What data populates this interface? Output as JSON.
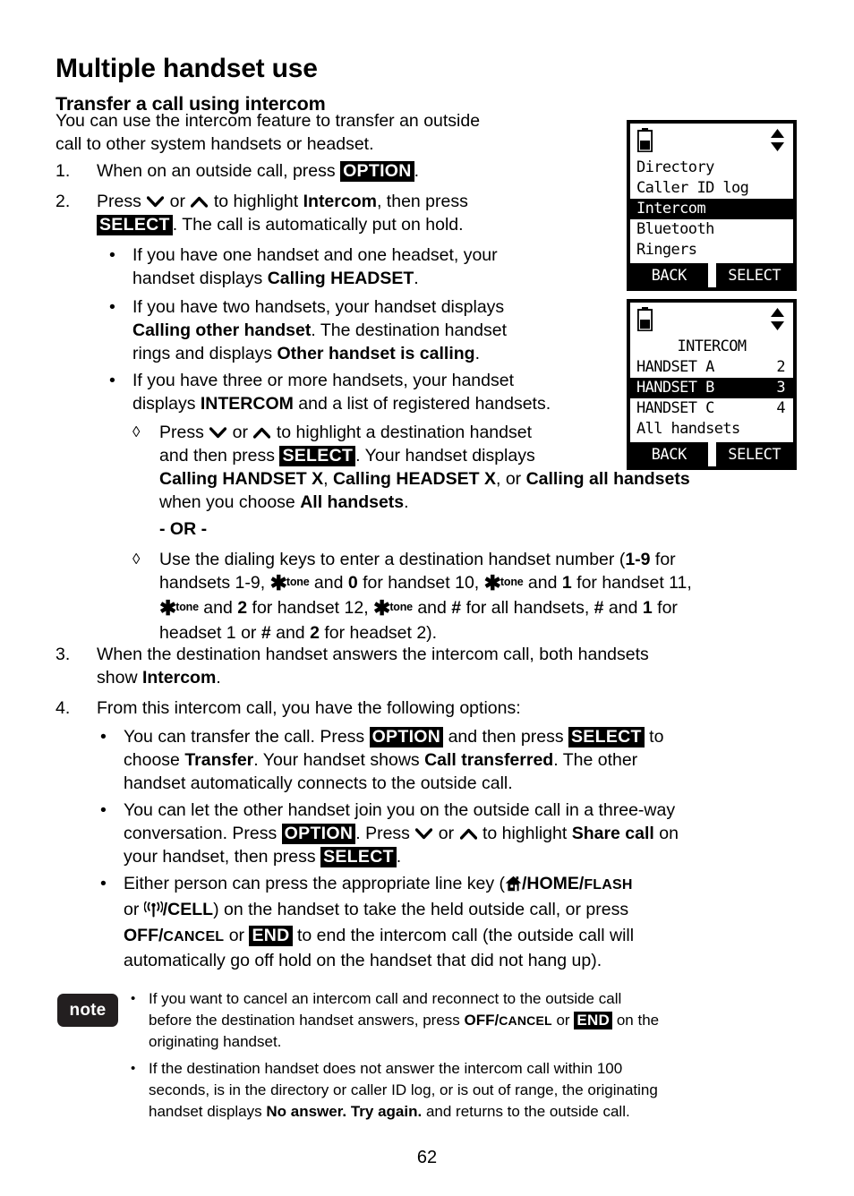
{
  "document": {
    "chapter_title": "Multiple handset use",
    "section_title": "Transfer a call using intercom",
    "page_number": "62"
  },
  "intro": {
    "line1": "You can use the intercom feature to transfer an outside",
    "line2": "call to other system handsets or headset."
  },
  "steps": {
    "s1": {
      "marker": "1.",
      "text_before": "When on an outside call, press ",
      "key": "OPTION",
      "text_after": "."
    },
    "s2": {
      "marker": "2.",
      "l1_a": "Press ",
      "l1_b": " or ",
      "l1_c": " to highlight ",
      "l1_bold": "Intercom",
      "l1_d": ", then press",
      "l2_key": "SELECT",
      "l2_after": ". The call is automatically put on hold.",
      "bullets": [
        {
          "l1": "If you have one handset and one headset, your",
          "l2_a": "handset displays ",
          "l2_bold": "Calling HEADSET",
          "l2_b": "."
        },
        {
          "l1": "If you have two handsets, your handset displays",
          "l2_bold": "Calling other handset",
          "l2_a": ". The destination handset",
          "l3_a": "rings and displays ",
          "l3_bold": "Other handset is calling",
          "l3_b": "."
        },
        {
          "l1": "If you have three or more handsets, your handset",
          "l2_a": "displays ",
          "l2_bold": "INTERCOM",
          "l2_b": " and a list of registered handsets."
        }
      ],
      "sub_items": [
        {
          "marker": "◊",
          "l1_a": "Press ",
          "l1_b": " or ",
          "l1_c": " to highlight a destination handset",
          "l2_a": "and then press ",
          "l2_key": "SELECT",
          "l2_b": ". Your handset displays",
          "l3_bold1": "Calling HANDSET X",
          "l3_sep1": ", ",
          "l3_bold2": "Calling HEADSET X",
          "l3_sep2": ", or ",
          "l3_bold3": "Calling all handsets",
          "l4_a": "when you choose ",
          "l4_bold": "All handsets",
          "l4_b": "."
        }
      ],
      "or_label": "- OR -",
      "sub_items2": [
        {
          "marker": "◊",
          "l1_a": "Use the dialing keys to enter a destination handset number (",
          "l1_b1": "1-9",
          "l1_c": " for",
          "l2_a": "handsets 1-9, ",
          "l2_star": "tone",
          "l2_b": " and ",
          "l2_b1": "0",
          "l2_c": " for handset 10, ",
          "l2_d": " and ",
          "l2_d1": "1",
          "l2_e": " for handset 11,",
          "l3_a": " and ",
          "l3_a1": "2",
          "l3_b": " for handset 12, ",
          "l3_c": " and ",
          "l3_c1": "#",
          "l3_d": " for all handsets, ",
          "l3_d1": "#",
          "l3_e": " and ",
          "l3_e1": "1",
          "l3_f": " for",
          "l4_a": "headset 1 or ",
          "l4_a1": "#",
          "l4_b": " and ",
          "l4_b1": "2",
          "l4_c": " for headset 2)."
        }
      ]
    },
    "s3": {
      "marker": "3.",
      "l1": "When the destination handset answers the intercom call, both handsets",
      "l2_a": "show ",
      "l2_bold": "Intercom",
      "l2_b": "."
    },
    "s4": {
      "marker": "4.",
      "l1": "From this intercom call, you have the following options:",
      "bullets": [
        {
          "l1_a": "You can transfer the call. Press ",
          "l1_key1": "OPTION",
          "l1_b": " and then press ",
          "l1_key2": "SELECT",
          "l1_c": " to",
          "l2_a": "choose ",
          "l2_bold1": "Transfer",
          "l2_b": ". Your handset shows ",
          "l2_bold2": "Call transferred",
          "l2_c": ". The other",
          "l3": "handset automatically connects to the outside call."
        },
        {
          "l1": "You can let the other handset join you on the outside call in a three-way",
          "l2_a": "conversation. Press ",
          "l2_key": "OPTION",
          "l2_b": ". Press ",
          "l2_c": " or ",
          "l2_d": " to highlight ",
          "l2_bold": "Share call",
          "l2_e": " on",
          "l3_a": "your handset, then press ",
          "l3_key": "SELECT",
          "l3_b": "."
        },
        {
          "l1_a": "Either person can press the appropriate line key (",
          "l1_home": "/HOME/",
          "l1_flash": "FLASH",
          "l2_a": "or ",
          "l2_cell": "/CELL",
          "l2_b": ") on the handset to take the held outside call, or press",
          "l3_off": "OFF/",
          "l3_cancel": "CANCEL",
          "l3_a": " or ",
          "l3_key": "END",
          "l3_b": " to end the intercom call (the outside call will",
          "l4": "automatically go off hold on the handset that did not hang up)."
        }
      ]
    }
  },
  "note": {
    "label": "note",
    "items": [
      {
        "l1": "If you want to cancel an intercom call and reconnect to the outside call",
        "l2_a": "before the destination handset answers, press ",
        "l2_off": "OFF/",
        "l2_cancel": "CANCEL",
        "l2_b": " or ",
        "l2_key": "END",
        "l2_c": " on the",
        "l3": "originating handset."
      },
      {
        "l1": "If the destination handset does not answer the intercom call within 100",
        "l2": "seconds, is in the directory or caller ID log, or is out of range, the originating",
        "l3_a": "handset displays ",
        "l3_bold": "No answer. Try again.",
        "l3_b": " and returns to the outside call."
      }
    ]
  },
  "lcd_screens": [
    {
      "id": "menu-screen",
      "rows": [
        {
          "label": "Directory",
          "value": "",
          "selected": false,
          "centered": false
        },
        {
          "label": "Caller ID log",
          "value": "",
          "selected": false,
          "centered": false
        },
        {
          "label": "Intercom",
          "value": "",
          "selected": true,
          "centered": false
        },
        {
          "label": "Bluetooth",
          "value": "",
          "selected": false,
          "centered": false
        },
        {
          "label": "Ringers",
          "value": "",
          "selected": false,
          "centered": false
        }
      ],
      "softkeys": {
        "left": "BACK",
        "right": "SELECT"
      }
    },
    {
      "id": "intercom-screen",
      "rows": [
        {
          "label": "INTERCOM",
          "value": "",
          "selected": false,
          "centered": true
        },
        {
          "label": "HANDSET A",
          "value": "2",
          "selected": false,
          "centered": false
        },
        {
          "label": "HANDSET B",
          "value": "3",
          "selected": true,
          "centered": false
        },
        {
          "label": "HANDSET C",
          "value": "4",
          "selected": false,
          "centered": false
        },
        {
          "label": "All handsets",
          "value": "",
          "selected": false,
          "centered": false
        }
      ],
      "softkeys": {
        "left": "BACK",
        "right": "SELECT"
      }
    }
  ]
}
